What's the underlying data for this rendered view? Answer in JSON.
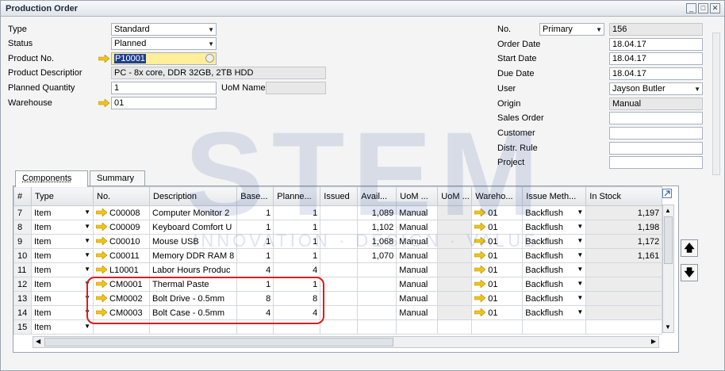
{
  "window": {
    "title": "Production Order"
  },
  "header_left": {
    "type_label": "Type",
    "type_value": "Standard",
    "status_label": "Status",
    "status_value": "Planned",
    "product_no_label": "Product No.",
    "product_no_value": "P10001",
    "product_desc_label": "Product Descriptior",
    "product_desc_value": "PC - 8x core, DDR 32GB, 2TB HDD",
    "planned_qty_label": "Planned Quantity",
    "planned_qty_value": "1",
    "uom_label": "UoM Name",
    "uom_value": "",
    "warehouse_label": "Warehouse",
    "warehouse_value": "01"
  },
  "header_right": {
    "no_label": "No.",
    "series_value": "Primary",
    "no_value": "156",
    "order_date_label": "Order Date",
    "order_date_value": "18.04.17",
    "start_date_label": "Start Date",
    "start_date_value": "18.04.17",
    "due_date_label": "Due Date",
    "due_date_value": "18.04.17",
    "user_label": "User",
    "user_value": "Jayson Butler",
    "origin_label": "Origin",
    "origin_value": "Manual",
    "sales_order_label": "Sales Order",
    "sales_order_value": "",
    "customer_label": "Customer",
    "customer_value": "",
    "distr_rule_label": "Distr. Rule",
    "distr_rule_value": "",
    "project_label": "Project",
    "project_value": ""
  },
  "tabs": [
    {
      "label": "Components",
      "active": true
    },
    {
      "label": "Summary",
      "active": false
    }
  ],
  "grid": {
    "columns": [
      "#",
      "Type",
      "No.",
      "Description",
      "Base...",
      "Planne...",
      "Issued",
      "Avail...",
      "UoM ...",
      "UoM ...",
      "Wareho...",
      "Issue Meth...",
      "In Stock"
    ],
    "rows": [
      {
        "num": "7",
        "type": "Item",
        "no": "C00008",
        "desc": "Computer Monitor 2",
        "base": "1",
        "planned": "1",
        "issued": "",
        "avail": "1,089",
        "uom": "Manual",
        "uom2": "",
        "wh": "01",
        "method": "Backflush",
        "stock": "1,197"
      },
      {
        "num": "8",
        "type": "Item",
        "no": "C00009",
        "desc": "Keyboard Comfort U",
        "base": "1",
        "planned": "1",
        "issued": "",
        "avail": "1,102",
        "uom": "Manual",
        "uom2": "",
        "wh": "01",
        "method": "Backflush",
        "stock": "1,198"
      },
      {
        "num": "9",
        "type": "Item",
        "no": "C00010",
        "desc": "Mouse USB",
        "base": "1",
        "planned": "1",
        "issued": "",
        "avail": "1,068",
        "uom": "Manual",
        "uom2": "",
        "wh": "01",
        "method": "Backflush",
        "stock": "1,172"
      },
      {
        "num": "10",
        "type": "Item",
        "no": "C00011",
        "desc": "Memory DDR RAM 8",
        "base": "1",
        "planned": "1",
        "issued": "",
        "avail": "1,070",
        "uom": "Manual",
        "uom2": "",
        "wh": "01",
        "method": "Backflush",
        "stock": "1,161"
      },
      {
        "num": "11",
        "type": "Item",
        "no": "L10001",
        "desc": "Labor Hours Produc",
        "base": "4",
        "planned": "4",
        "issued": "",
        "avail": "",
        "uom": "Manual",
        "uom2": "",
        "wh": "01",
        "method": "Backflush",
        "stock": ""
      },
      {
        "num": "12",
        "type": "Item",
        "no": "CM0001",
        "desc": "Thermal Paste",
        "base": "1",
        "planned": "1",
        "issued": "",
        "avail": "",
        "uom": "Manual",
        "uom2": "",
        "wh": "01",
        "method": "Backflush",
        "stock": ""
      },
      {
        "num": "13",
        "type": "Item",
        "no": "CM0002",
        "desc": "Bolt Drive - 0.5mm",
        "base": "8",
        "planned": "8",
        "issued": "",
        "avail": "",
        "uom": "Manual",
        "uom2": "",
        "wh": "01",
        "method": "Backflush",
        "stock": ""
      },
      {
        "num": "14",
        "type": "Item",
        "no": "CM0003",
        "desc": "Bolt Case - 0.5mm",
        "base": "4",
        "planned": "4",
        "issued": "",
        "avail": "",
        "uom": "Manual",
        "uom2": "",
        "wh": "01",
        "method": "Backflush",
        "stock": ""
      },
      {
        "num": "15",
        "type": "Item",
        "no": "",
        "desc": "",
        "base": "",
        "planned": "",
        "issued": "",
        "avail": "",
        "uom": "",
        "uom2": "",
        "wh": "",
        "method": "",
        "stock": ""
      }
    ]
  },
  "watermark": {
    "brand": "STEM",
    "tagline": "INNOVATION · DESIGN · VALUE"
  },
  "colors": {
    "accent_arrow": "#f0c419",
    "highlight_box": "#e01b1b",
    "selection": "#1f3f8f"
  }
}
